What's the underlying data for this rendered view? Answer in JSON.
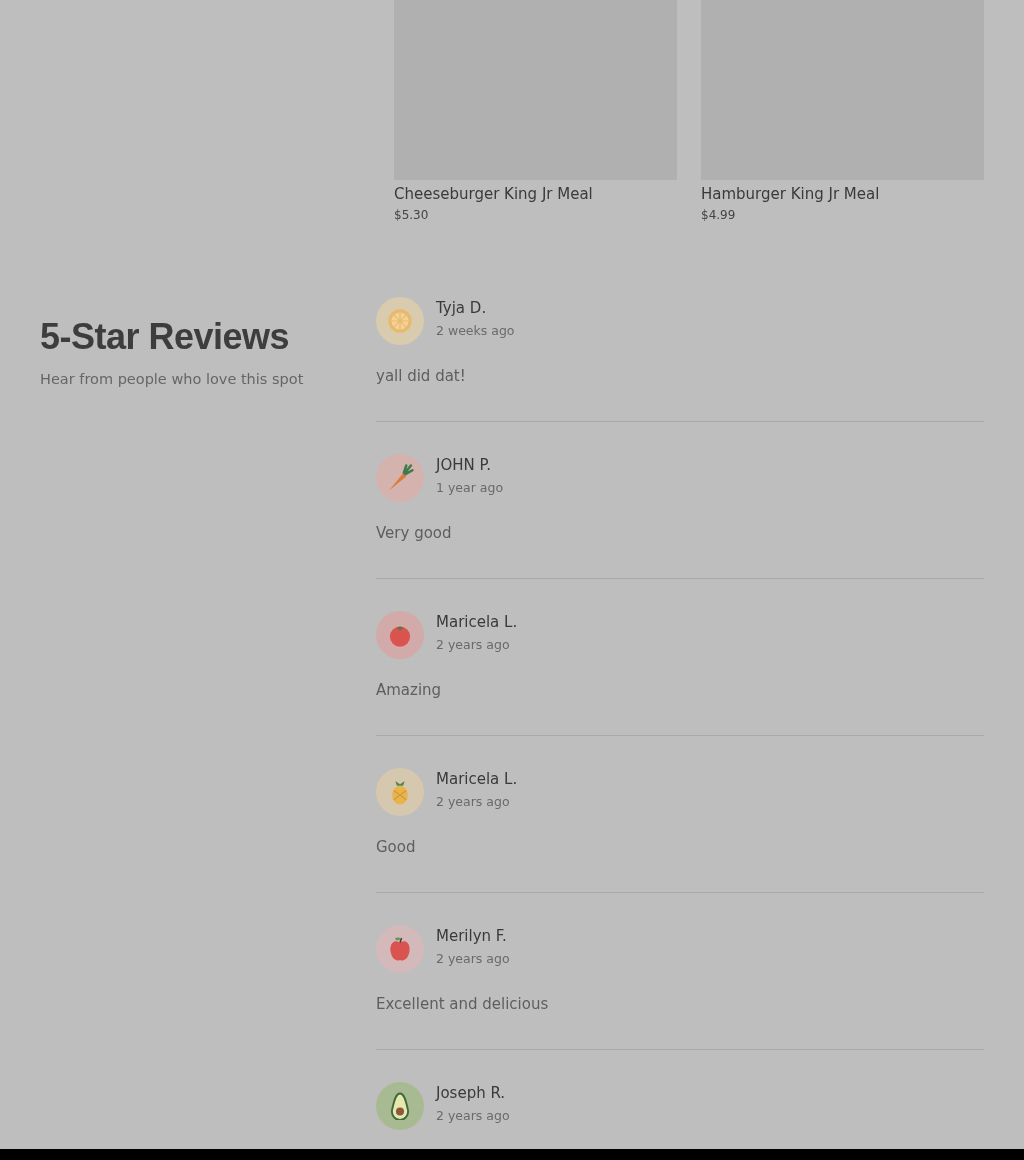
{
  "menu_items": [
    {
      "name": "Cheeseburger King Jr Meal",
      "price": "$5.30",
      "image": {
        "kind": "placeholder"
      }
    },
    {
      "name": "Hamburger King Jr Meal",
      "price": "$4.99",
      "image": {
        "kind": "placeholder"
      }
    }
  ],
  "reviews_section": {
    "title": "5-Star Reviews",
    "subtitle": "Hear from people who love this spot",
    "reviews": [
      {
        "avatar": {
          "kind": "lemon"
        },
        "name": "Tyja D.",
        "time": "2 weeks ago",
        "text": "yall did dat!"
      },
      {
        "avatar": {
          "kind": "carrot"
        },
        "name": "JOHN P.",
        "time": "1 year ago",
        "text": "Very good"
      },
      {
        "avatar": {
          "kind": "tomato"
        },
        "name": "Maricela L.",
        "time": "2 years ago",
        "text": "Amazing"
      },
      {
        "avatar": {
          "kind": "pineapple"
        },
        "name": "Maricela L.",
        "time": "2 years ago",
        "text": "Good"
      },
      {
        "avatar": {
          "kind": "apple"
        },
        "name": "Merilyn F.",
        "time": "2 years ago",
        "text": "Excellent and delicious"
      },
      {
        "avatar": {
          "kind": "avocado"
        },
        "name": "Joseph R.",
        "time": "2 years ago"
      }
    ]
  }
}
